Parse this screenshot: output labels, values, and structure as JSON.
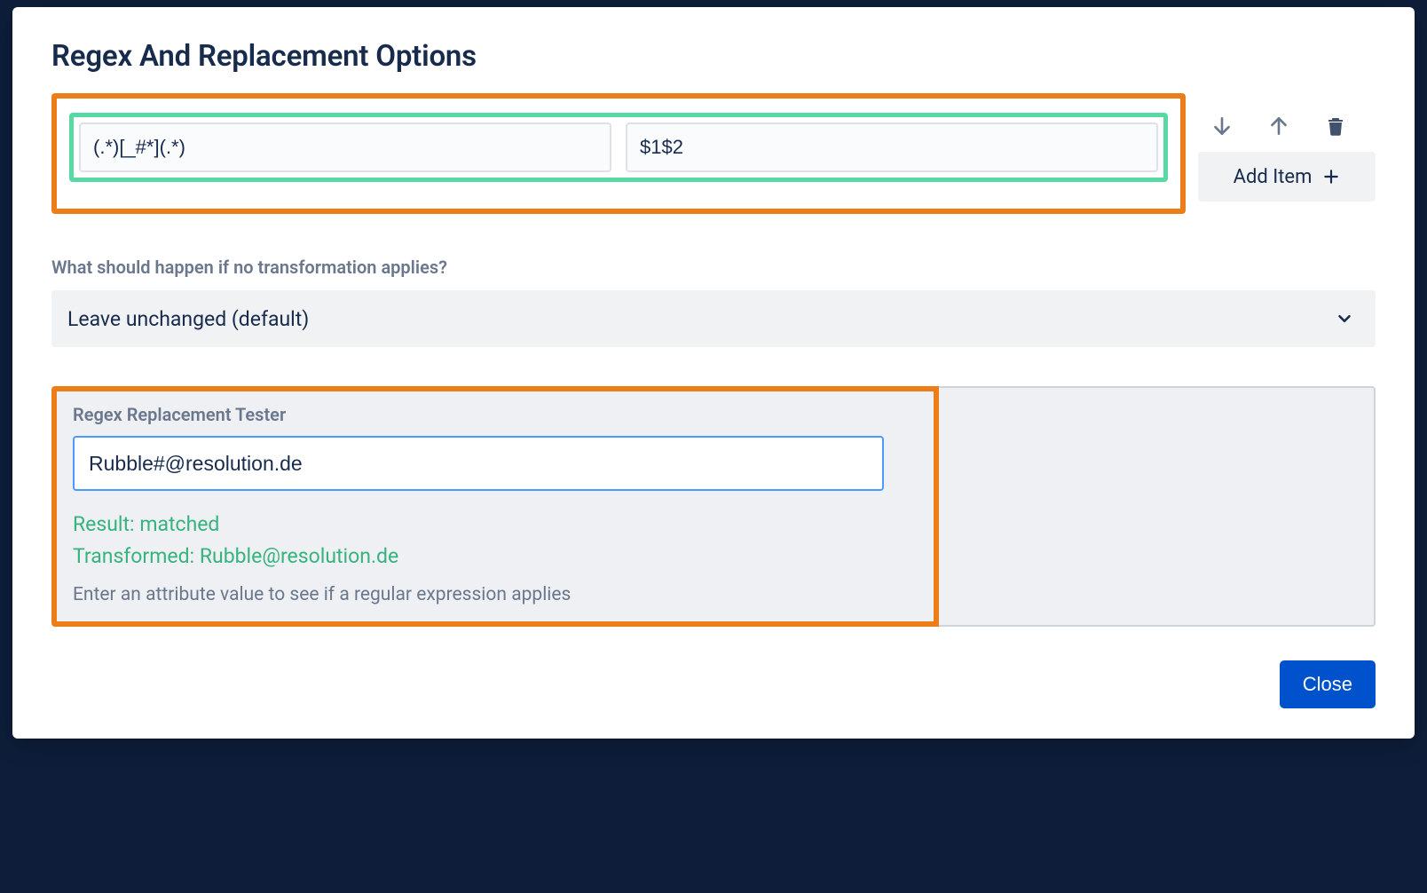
{
  "modal": {
    "title": "Regex And Replacement Options",
    "rules": [
      {
        "pattern": "(.*)[_#*](.*)",
        "replacement": "$1$2"
      }
    ],
    "add_item_label": "Add Item",
    "fallback": {
      "label": "What should happen if no transformation applies?",
      "selected": "Leave unchanged (default)"
    },
    "tester": {
      "title": "Regex Replacement Tester",
      "input_value": "Rubble#@resolution.de",
      "result_label": "Result:",
      "result_value": "matched",
      "transformed_label": "Transformed:",
      "transformed_value": "Rubble@resolution.de",
      "helper": "Enter an attribute value to see if a regular expression applies"
    },
    "close_label": "Close"
  }
}
